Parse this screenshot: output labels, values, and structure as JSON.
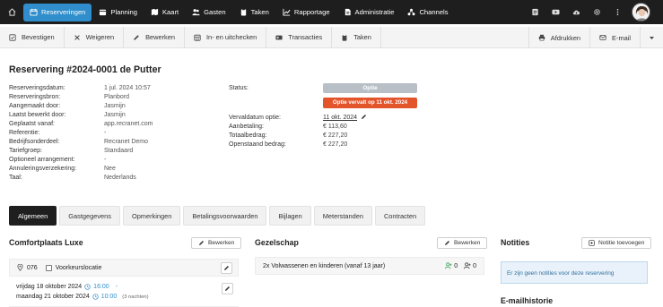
{
  "nav": {
    "items": [
      {
        "label": "Reserveringen",
        "active": true,
        "icon": "calendar-icon"
      },
      {
        "label": "Planning",
        "active": false,
        "icon": "planning-icon"
      },
      {
        "label": "Kaart",
        "active": false,
        "icon": "map-icon"
      },
      {
        "label": "Gasten",
        "active": false,
        "icon": "users-icon"
      },
      {
        "label": "Taken",
        "active": false,
        "icon": "clipboard-icon"
      },
      {
        "label": "Rapportage",
        "active": false,
        "icon": "chart-icon"
      },
      {
        "label": "Administratie",
        "active": false,
        "icon": "document-icon"
      },
      {
        "label": "Channels",
        "active": false,
        "icon": "channels-icon"
      }
    ],
    "accent": "#2f8ecb"
  },
  "toolbar": {
    "left": [
      "Bevestigen",
      "Weigeren",
      "Bewerken",
      "In- en uitchecken",
      "Transacties",
      "Taken"
    ],
    "right": [
      "Afdrukken",
      "E-mail"
    ]
  },
  "reservation": {
    "title": "Reservering #2024-0001 de Putter",
    "details": [
      {
        "label": "Reserveringsdatum:",
        "value": "1 jul. 2024 10:57"
      },
      {
        "label": "Reserveringsbron:",
        "value": "Planbord"
      },
      {
        "label": "Aangemaakt door:",
        "value": "Jasmijn"
      },
      {
        "label": "Laatst bewerkt door:",
        "value": "Jasmijn"
      },
      {
        "label": "Geplaatst vanaf:",
        "value": "app.recranet.com"
      },
      {
        "label": "Referentie:",
        "value": "-"
      },
      {
        "label": "Bedrijfsonderdeel:",
        "value": "Recranet Demo"
      },
      {
        "label": "Tariefgroep:",
        "value": "Standaard"
      },
      {
        "label": "Optioneel arrangement:",
        "value": "-"
      },
      {
        "label": "Annuleringsverzekering:",
        "value": "Nee"
      },
      {
        "label": "Taal:",
        "value": "Nederlands"
      }
    ],
    "status_label": "Status:",
    "status_value": "Optie",
    "expire_notice": "Optie vervalt op 11 okt. 2024",
    "expire_label": "Vervaldatum optie:",
    "expire_date": "11 okt. 2024",
    "payments": [
      {
        "label": "Aanbetaling:",
        "value": "€ 113,60"
      },
      {
        "label": "Totaalbedrag:",
        "value": "€ 227,20"
      },
      {
        "label": "Openstaand bedrag:",
        "value": "€ 227,20"
      }
    ],
    "status_color": "#b8bfc6",
    "expire_color": "#e4542b"
  },
  "tabs": [
    "Algemeen",
    "Gastgegevens",
    "Opmerkingen",
    "Betalingsvoorwaarden",
    "Bijlagen",
    "Meterstanden",
    "Contracten"
  ],
  "accommodation": {
    "title": "Comfortplaats Luxe",
    "edit_label": "Bewerken",
    "place": "076",
    "preference_label": "Voorkeurslocatie",
    "arrival_date": "vrijdag 18 oktober 2024",
    "arrival_time": "16:00",
    "departure_date": "maandag 21 oktober 2024",
    "departure_time": "10:00",
    "nights": "(3 nachten)",
    "dash": "-"
  },
  "company": {
    "title": "Gezelschap",
    "edit_label": "Bewerken",
    "description": "2x Volwassenen en kinderen (vanaf 13 jaar)",
    "count_a": "0",
    "count_b": "0"
  },
  "notes": {
    "title": "Notities",
    "add_label": "Notitie toevoegen",
    "empty": "Er zijn geen notities voor deze reservering"
  },
  "email_history": {
    "title": "E-mailhistorie"
  }
}
